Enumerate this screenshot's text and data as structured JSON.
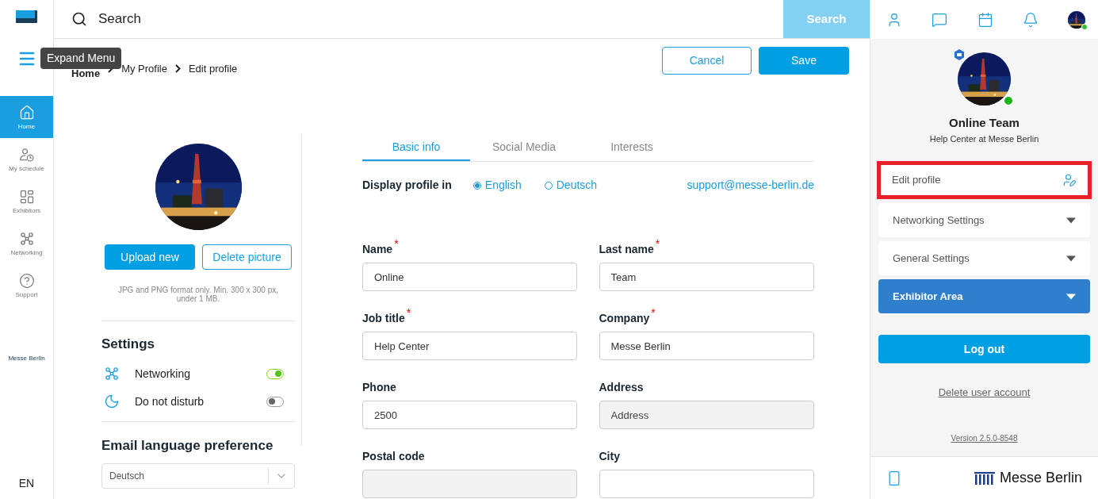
{
  "sidebar": {
    "items": [
      {
        "label": "Home",
        "kind": "home",
        "selected": true
      },
      {
        "label": "My schedule",
        "kind": "schedule",
        "selected": false
      },
      {
        "label": "Exhibitors",
        "kind": "grid",
        "selected": false
      },
      {
        "label": "Networking",
        "kind": "network",
        "selected": false
      },
      {
        "label": "Support",
        "kind": "help",
        "selected": false
      }
    ],
    "logo_text": "Messe Berlin",
    "language": "EN"
  },
  "tooltip": "Expand Menu",
  "search": {
    "placeholder": "Search",
    "button": "Search"
  },
  "breadcrumb": [
    "Home",
    "My Profile",
    "Edit profile"
  ],
  "actions": {
    "cancel": "Cancel",
    "save": "Save"
  },
  "picture": {
    "upload": "Upload new",
    "delete": "Delete picture",
    "hint": "JPG and PNG format only. Min. 300 x 300 px, under 1 MB."
  },
  "settings": {
    "title": "Settings",
    "toggles": [
      {
        "label": "Networking",
        "kind": "network",
        "on": true
      },
      {
        "label": "Do not disturb",
        "kind": "moon",
        "on": false
      }
    ]
  },
  "email_language": {
    "title": "Email language preference",
    "value": "Deutsch"
  },
  "tabs": [
    {
      "label": "Basic info",
      "selected": true
    },
    {
      "label": "Social Media",
      "selected": false
    },
    {
      "label": "Interests",
      "selected": false
    }
  ],
  "display_profile": {
    "label": "Display profile in",
    "options": [
      {
        "label": "English",
        "selected": true
      },
      {
        "label": "Deutsch",
        "selected": false
      }
    ],
    "email": "support@messe-berlin.de"
  },
  "fields": [
    {
      "label": "Name",
      "required_mark": "*",
      "value": "Online",
      "disabled": false
    },
    {
      "label": "Last name",
      "required_mark": "*",
      "value": "Team",
      "disabled": false
    },
    {
      "label": "Job title",
      "required_mark": "*",
      "value": "Help Center",
      "disabled": false
    },
    {
      "label": "Company",
      "required_mark": "*",
      "value": "Messe Berlin",
      "disabled": false
    },
    {
      "label": "Phone",
      "value": "2500",
      "disabled": false
    },
    {
      "label": "Address",
      "placeholder": "Address",
      "disabled": true
    },
    {
      "label": "Postal code",
      "disabled": true
    },
    {
      "label": "City",
      "disabled": false
    }
  ],
  "profile_panel": {
    "name": "Online Team",
    "subtitle": "Help Center at Messe Berlin",
    "online": true,
    "menu": [
      {
        "label": "Edit profile",
        "kind": "link",
        "highlighted": true
      },
      {
        "label": "Networking Settings",
        "kind": "dropdown",
        "highlighted": false
      },
      {
        "label": "General Settings",
        "kind": "dropdown",
        "highlighted": false
      },
      {
        "label": "Exhibitor Area",
        "kind": "primary",
        "highlighted": false
      }
    ],
    "logout": "Log out",
    "delete_account": "Delete user account",
    "version": "Version 2.5.0-8548",
    "brand": "Messe Berlin"
  }
}
